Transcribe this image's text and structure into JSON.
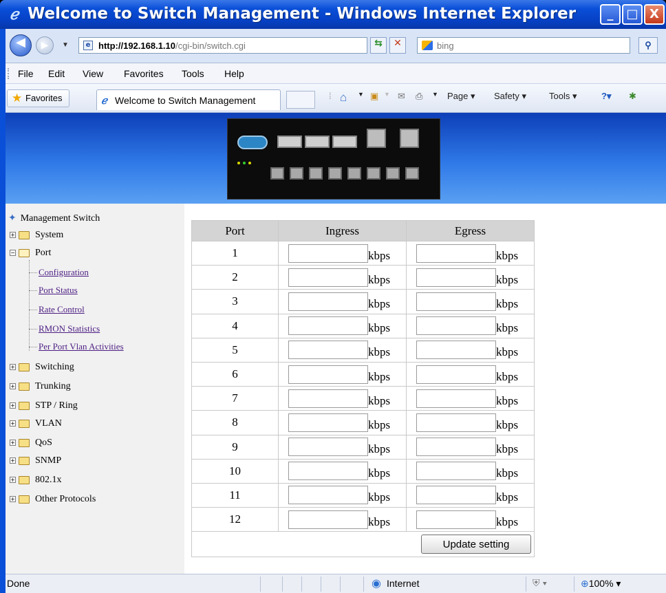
{
  "window": {
    "title": "Welcome to Switch Management - Windows Internet Explorer",
    "minimize": "_",
    "maximize": "□",
    "close": "X"
  },
  "address": {
    "url_host": "http://192.168.1.10",
    "url_path": "/cgi-bin/switch.cgi",
    "search_placeholder": "bing"
  },
  "menu": [
    "File",
    "Edit",
    "View",
    "Favorites",
    "Tools",
    "Help"
  ],
  "favbar": {
    "favorites_label": "Favorites",
    "tab_title": "Welcome to Switch Management",
    "page_label": "Page",
    "safety_label": "Safety",
    "tools_label": "Tools"
  },
  "sidebar": {
    "root": "Management Switch",
    "folders": [
      "System",
      "Port"
    ],
    "port_children": [
      "Configuration",
      "Port Status",
      "Rate Control",
      "RMON Statistics",
      "Per Port Vlan Activities"
    ],
    "more_folders": [
      "Switching",
      "Trunking",
      "STP / Ring",
      "VLAN",
      "QoS",
      "SNMP",
      "802.1x",
      "Other Protocols"
    ]
  },
  "rate_table": {
    "headers": [
      "Port",
      "Ingress",
      "Egress"
    ],
    "unit": "kbps",
    "ports": [
      "1",
      "2",
      "3",
      "4",
      "5",
      "6",
      "7",
      "8",
      "9",
      "10",
      "11",
      "12"
    ],
    "update_label": "Update setting"
  },
  "status": {
    "left": "Done",
    "zone": "Internet",
    "zoom": "100%"
  }
}
